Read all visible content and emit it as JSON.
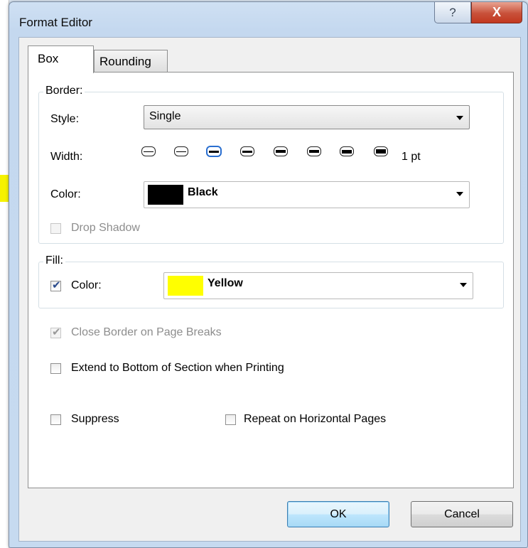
{
  "window": {
    "title": "Format Editor",
    "help_icon": "?",
    "close_icon": "X"
  },
  "tabs": [
    {
      "label": "Box",
      "selected": true
    },
    {
      "label": "Rounding",
      "selected": false
    }
  ],
  "border": {
    "legend": "Border:",
    "style_label": "Style:",
    "style_value": "Single",
    "width_label": "Width:",
    "width_value": "1 pt",
    "width_options_count_selected_index": 2,
    "color_label": "Color:",
    "color_value": "Black",
    "color_hex": "#000000",
    "drop_shadow_label": "Drop Shadow",
    "drop_shadow_checked": false,
    "drop_shadow_enabled": false
  },
  "fill": {
    "legend": "Fill:",
    "color_label": "Color:",
    "color_checked": true,
    "color_value": "Yellow",
    "color_hex": "#ffff00"
  },
  "options": {
    "close_border_label": "Close Border on Page Breaks",
    "close_border_checked": true,
    "close_border_enabled": false,
    "extend_label": "Extend to Bottom of Section when Printing",
    "extend_checked": false,
    "suppress_label": "Suppress",
    "suppress_checked": false,
    "repeat_label": "Repeat on Horizontal Pages",
    "repeat_checked": false
  },
  "buttons": {
    "ok": "OK",
    "cancel": "Cancel"
  }
}
